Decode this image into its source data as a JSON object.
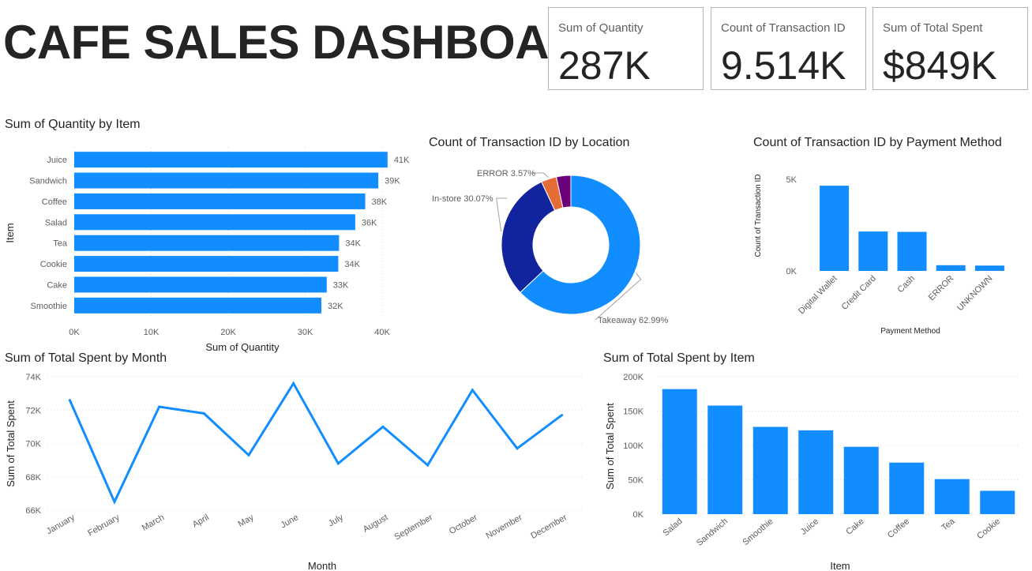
{
  "dashboard": {
    "title": "CAFE SALES DASHBOARD"
  },
  "cards": [
    {
      "label": "Sum of Quantity",
      "value": "287K"
    },
    {
      "label": "Count of Transaction ID",
      "value": "9.514K"
    },
    {
      "label": "Sum of Total Spent",
      "value": "$849K"
    }
  ],
  "colors": {
    "primary": "#118dff",
    "dark_blue": "#12239e",
    "orange": "#e66c37",
    "purple": "#6b007b",
    "grid": "#e1dfdd",
    "text": "#605e5c"
  },
  "chart_data": [
    {
      "id": "qty_by_item",
      "type": "bar",
      "orientation": "horizontal",
      "title": "Sum of Quantity by Item",
      "xlabel": "Sum of Quantity",
      "ylabel": "Item",
      "categories": [
        "Juice",
        "Sandwich",
        "Coffee",
        "Salad",
        "Tea",
        "Cookie",
        "Cake",
        "Smoothie"
      ],
      "values": [
        40700,
        39500,
        37800,
        36500,
        34400,
        34300,
        32800,
        32100
      ],
      "data_labels": [
        "41K",
        "39K",
        "38K",
        "36K",
        "34K",
        "34K",
        "33K",
        "32K"
      ],
      "xlim": [
        0,
        40000
      ],
      "xticks": [
        0,
        10000,
        20000,
        30000,
        40000
      ],
      "xtick_labels": [
        "0K",
        "10K",
        "20K",
        "30K",
        "40K"
      ],
      "grid": true
    },
    {
      "id": "tx_by_location",
      "type": "pie",
      "donut": true,
      "title": "Count of Transaction ID by Location",
      "slices": [
        {
          "name": "Takeaway",
          "value": 62.99,
          "label": "Takeaway 62.99%",
          "color": "#118dff"
        },
        {
          "name": "In-store",
          "value": 30.07,
          "label": "In-store 30.07%",
          "color": "#12239e"
        },
        {
          "name": "ERROR",
          "value": 3.57,
          "label": "ERROR 3.57%",
          "color": "#e66c37"
        },
        {
          "name": "",
          "value": 3.37,
          "label": "",
          "color": "#6b007b"
        }
      ]
    },
    {
      "id": "tx_by_payment",
      "type": "bar",
      "title": "Count of Transaction ID by Payment Method",
      "xlabel": "Payment Method",
      "ylabel": "Count of Transaction ID",
      "categories": [
        "Digital Wallet",
        "Credit Card",
        "Cash",
        "ERROR",
        "UNKNOWN"
      ],
      "values": [
        4650,
        2150,
        2130,
        310,
        290
      ],
      "ylim": [
        0,
        5000
      ],
      "yticks": [
        0,
        5000
      ],
      "ytick_labels": [
        "0K",
        "5K"
      ],
      "grid": false
    },
    {
      "id": "spent_by_month",
      "type": "line",
      "title": "Sum of Total Spent by Month",
      "xlabel": "Month",
      "ylabel": "Sum of Total Spent",
      "categories": [
        "January",
        "February",
        "March",
        "April",
        "May",
        "June",
        "July",
        "August",
        "September",
        "October",
        "November",
        "December"
      ],
      "values": [
        72600,
        66500,
        72200,
        71800,
        69300,
        73600,
        68800,
        71000,
        68700,
        73200,
        69700,
        71700
      ],
      "ylim": [
        66000,
        74000
      ],
      "yticks": [
        66000,
        68000,
        70000,
        72000,
        74000
      ],
      "ytick_labels": [
        "66K",
        "68K",
        "70K",
        "72K",
        "74K"
      ],
      "grid": true
    },
    {
      "id": "spent_by_item",
      "type": "bar",
      "title": "Sum of Total Spent by Item",
      "xlabel": "Item",
      "ylabel": "Sum of Total Spent",
      "categories": [
        "Salad",
        "Sandwich",
        "Smoothie",
        "Juice",
        "Cake",
        "Coffee",
        "Tea",
        "Cookie"
      ],
      "values": [
        182000,
        158000,
        127000,
        122000,
        98000,
        75000,
        51000,
        34000
      ],
      "ylim": [
        0,
        200000
      ],
      "yticks": [
        0,
        50000,
        100000,
        150000,
        200000
      ],
      "ytick_labels": [
        "0K",
        "50K",
        "100K",
        "150K",
        "200K"
      ],
      "grid": true
    }
  ]
}
